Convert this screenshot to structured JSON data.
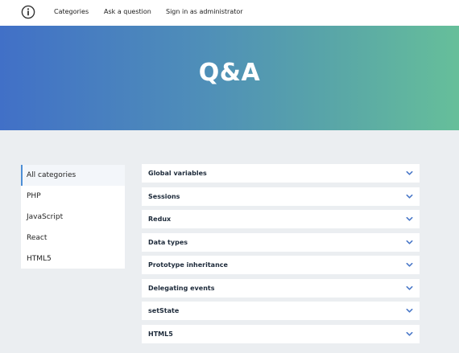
{
  "nav": {
    "logo_icon": "info-circle-icon",
    "links": [
      {
        "label": "Categories"
      },
      {
        "label": "Ask a question"
      },
      {
        "label": "Sign in as administrator"
      }
    ]
  },
  "hero": {
    "title": "Q&A"
  },
  "sidebar": {
    "items": [
      {
        "label": "All categories",
        "active": true
      },
      {
        "label": "PHP"
      },
      {
        "label": "JavaScript"
      },
      {
        "label": "React"
      },
      {
        "label": "HTML5"
      }
    ]
  },
  "questions": {
    "chevron_icon": "chevron-down-icon",
    "items": [
      {
        "label": "Global variables"
      },
      {
        "label": "Sessions"
      },
      {
        "label": "Redux"
      },
      {
        "label": "Data types"
      },
      {
        "label": "Prototype inheritance"
      },
      {
        "label": "Delegating events"
      },
      {
        "label": "setState"
      },
      {
        "label": "HTML5"
      }
    ]
  },
  "colors": {
    "gradient_start": "#4170c7",
    "gradient_end": "#66bf9a",
    "accent": "#4d8fd6",
    "chevron": "#4a78c8",
    "background": "#ebeef1"
  }
}
